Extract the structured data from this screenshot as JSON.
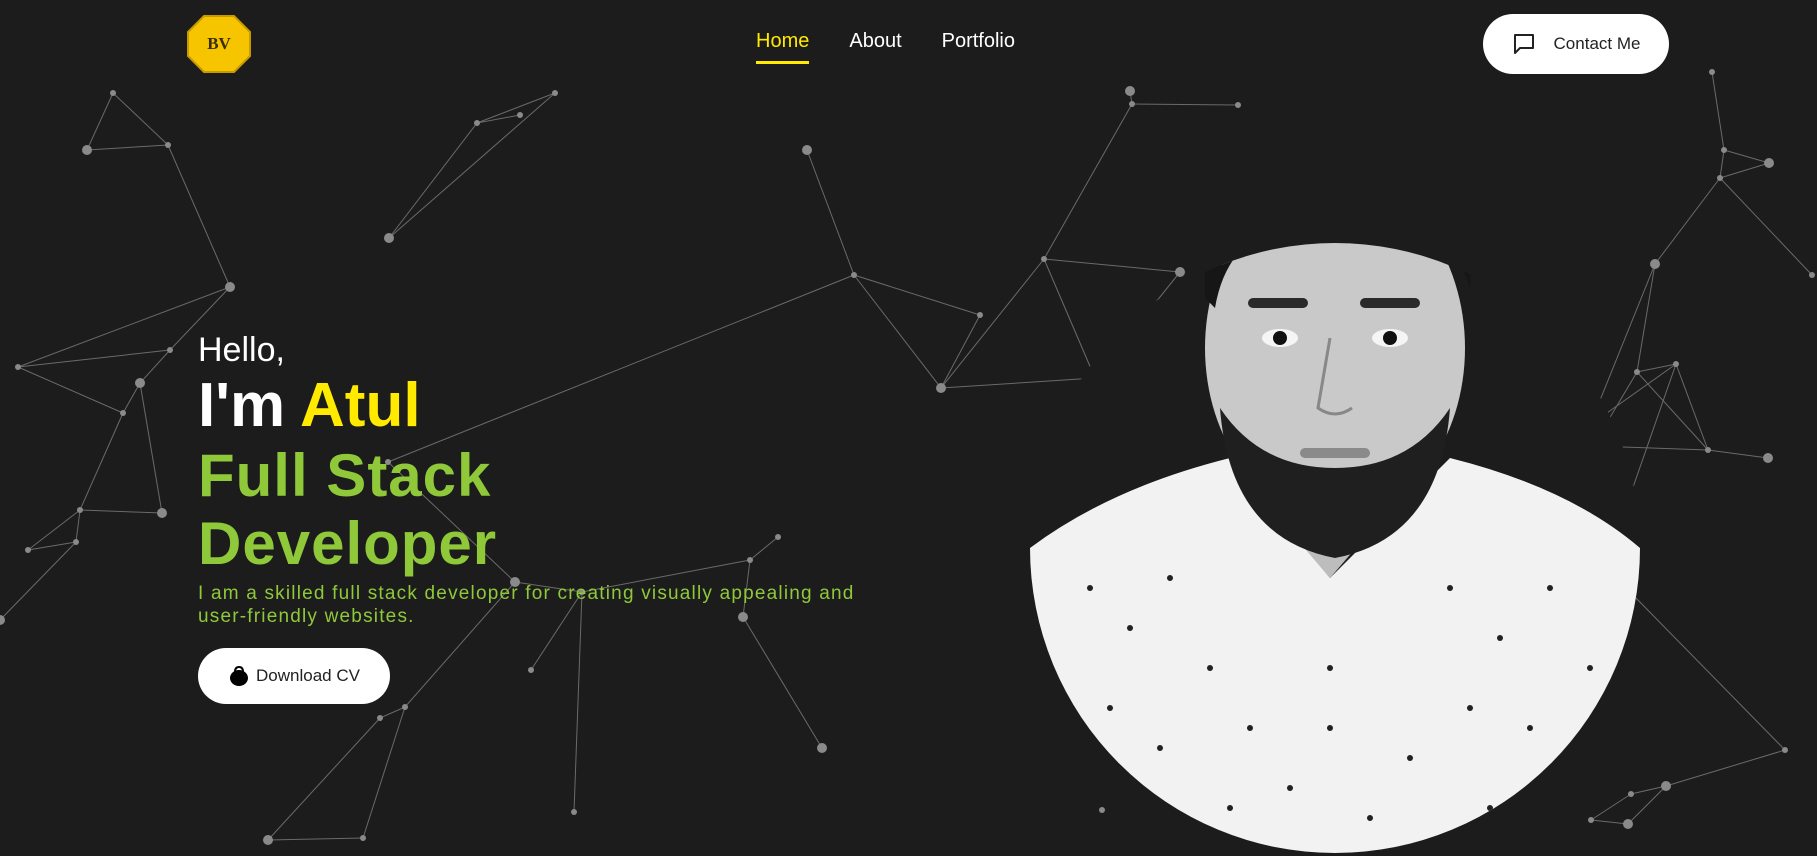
{
  "brand": {
    "logo_text": "BV",
    "accent": "#ffea00",
    "green": "#8fc93a",
    "background": "#1c1c1c"
  },
  "nav": {
    "items": [
      {
        "label": "Home",
        "active": true
      },
      {
        "label": "About",
        "active": false
      },
      {
        "label": "Portfolio",
        "active": false
      }
    ]
  },
  "contact_button": {
    "label": "Contact Me",
    "icon": "chat-icon"
  },
  "hero": {
    "greeting": "Hello,",
    "intro": "I'm ",
    "name": "Atul",
    "role_line1": "Full Stack",
    "role_line2": "Developer",
    "description": "I am a skilled full stack developer for creating visually appealing and user-friendly websites.",
    "cta_label": "Download CV",
    "cta_icon": "bag-icon"
  },
  "portrait": {
    "style": "grayscale"
  }
}
